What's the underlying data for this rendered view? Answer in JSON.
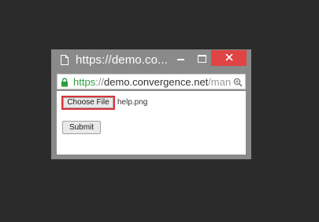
{
  "window": {
    "title": "https://demo.co...",
    "address": {
      "scheme": "https",
      "separator": "://",
      "host": "demo.convergence.net",
      "path": "/man"
    }
  },
  "form": {
    "choose_file_label": "Choose File",
    "file_name": "help.png",
    "submit_label": "Submit"
  },
  "icons": {
    "page": "page-icon",
    "minimize": "minimize-icon",
    "maximize": "maximize-icon",
    "close": "close-icon",
    "lock": "lock-icon",
    "zoom": "zoom-icon"
  },
  "colors": {
    "close_button": "#e04343",
    "secure_scheme": "#2e9e3e",
    "focus_outline": "#d9343a"
  }
}
